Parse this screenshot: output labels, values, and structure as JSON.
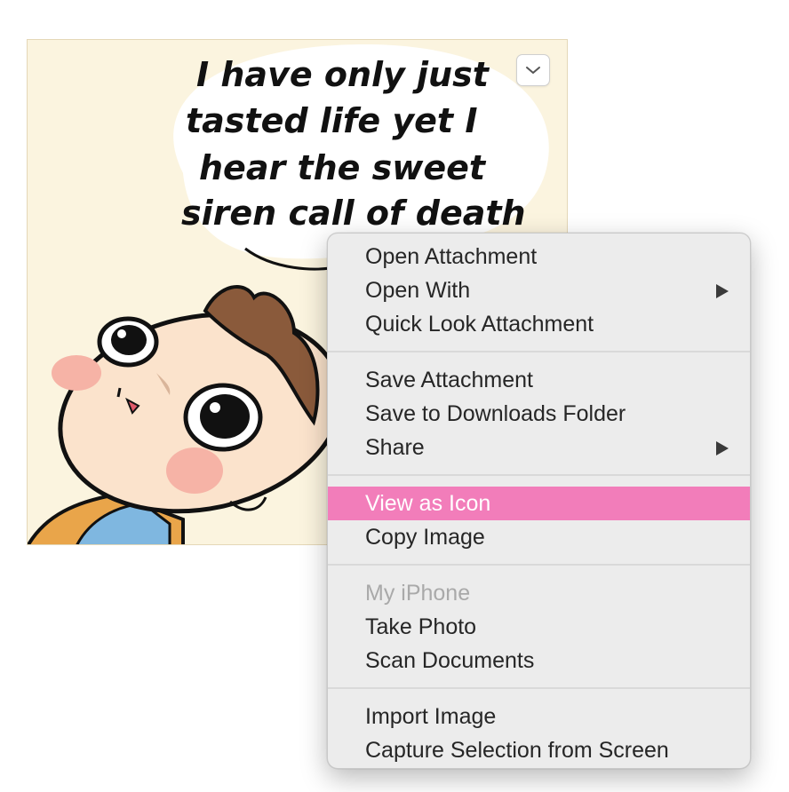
{
  "attachment": {
    "speech_lines": [
      "I have only just",
      "tasted life yet I",
      "hear the sweet",
      "siren call of death"
    ],
    "expand_icon": "chevron-down-icon"
  },
  "menu": {
    "groups": [
      {
        "items": [
          {
            "label": "Open Attachment"
          },
          {
            "label": "Open With",
            "submenu_icon": "chevron-right-icon"
          },
          {
            "label": "Quick Look Attachment"
          }
        ]
      },
      {
        "items": [
          {
            "label": "Save Attachment"
          },
          {
            "label": "Save to Downloads Folder"
          },
          {
            "label": "Share",
            "submenu_icon": "chevron-right-icon"
          }
        ]
      },
      {
        "items": [
          {
            "label": "View as Icon",
            "highlighted": true
          },
          {
            "label": "Copy Image"
          }
        ]
      },
      {
        "items": [
          {
            "label": "My iPhone",
            "disabled": true
          },
          {
            "label": "Take Photo"
          },
          {
            "label": "Scan Documents"
          }
        ]
      },
      {
        "items": [
          {
            "label": "Import Image"
          },
          {
            "label": "Capture Selection from Screen"
          }
        ]
      }
    ]
  },
  "colors": {
    "highlight": "#f27dba",
    "menu_background": "#ececec",
    "comic_background": "#fbf4df"
  }
}
